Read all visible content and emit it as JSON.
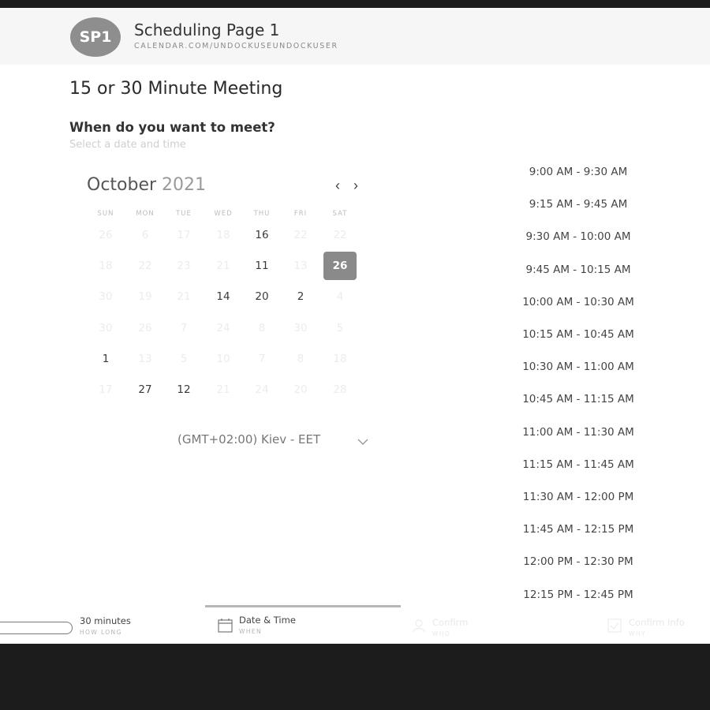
{
  "header": {
    "avatar_initials": "SP1",
    "page_name": "Scheduling Page 1",
    "page_url": "CALENDAR.COM/UNDOCKUSEUNDOCKUSER"
  },
  "event": {
    "title": "15 or 30 Minute Meeting",
    "question": "When do you want to meet?",
    "subtitle": "Select a date and time"
  },
  "calendar": {
    "month": "October",
    "year": "2021",
    "prev_icon": "‹",
    "next_icon": "›",
    "weekdays": [
      "SUN",
      "MON",
      "TUE",
      "WED",
      "THU",
      "FRI",
      "SAT"
    ],
    "weeks": [
      [
        {
          "t": "26",
          "s": "muted"
        },
        {
          "t": "6",
          "s": "muted"
        },
        {
          "t": "17",
          "s": "muted"
        },
        {
          "t": "18",
          "s": "muted"
        },
        {
          "t": "16",
          "s": "avail"
        },
        {
          "t": "22",
          "s": "muted"
        },
        {
          "t": "22",
          "s": "muted"
        }
      ],
      [
        {
          "t": "18",
          "s": "muted"
        },
        {
          "t": "22",
          "s": "muted"
        },
        {
          "t": "23",
          "s": "muted"
        },
        {
          "t": "21",
          "s": "muted"
        },
        {
          "t": "11",
          "s": "avail"
        },
        {
          "t": "13",
          "s": "muted"
        },
        {
          "t": "26",
          "s": "selected"
        }
      ],
      [
        {
          "t": "30",
          "s": "muted"
        },
        {
          "t": "19",
          "s": "muted"
        },
        {
          "t": "21",
          "s": "muted"
        },
        {
          "t": "14",
          "s": "avail"
        },
        {
          "t": "20",
          "s": "avail"
        },
        {
          "t": "2",
          "s": "avail"
        },
        {
          "t": "4",
          "s": "muted"
        }
      ],
      [
        {
          "t": "30",
          "s": "muted"
        },
        {
          "t": "26",
          "s": "muted"
        },
        {
          "t": "7",
          "s": "muted"
        },
        {
          "t": "24",
          "s": "muted"
        },
        {
          "t": "8",
          "s": "muted"
        },
        {
          "t": "30",
          "s": "muted"
        },
        {
          "t": "5",
          "s": "muted"
        }
      ],
      [
        {
          "t": "1",
          "s": "avail"
        },
        {
          "t": "13",
          "s": "muted"
        },
        {
          "t": "5",
          "s": "muted"
        },
        {
          "t": "10",
          "s": "muted"
        },
        {
          "t": "7",
          "s": "muted"
        },
        {
          "t": "8",
          "s": "muted"
        },
        {
          "t": "18",
          "s": "muted"
        }
      ],
      [
        {
          "t": "17",
          "s": "muted"
        },
        {
          "t": "27",
          "s": "avail"
        },
        {
          "t": "12",
          "s": "avail"
        },
        {
          "t": "21",
          "s": "muted"
        },
        {
          "t": "24",
          "s": "muted"
        },
        {
          "t": "20",
          "s": "muted"
        },
        {
          "t": "28",
          "s": "muted"
        }
      ]
    ],
    "timezone": "(GMT+02:00) Kiev - EET"
  },
  "slots": [
    "9:00 AM - 9:30 AM",
    "9:15 AM - 9:45 AM",
    "9:30 AM - 10:00 AM",
    "9:45 AM - 10:15 AM",
    "10:00 AM - 10:30 AM",
    "10:15 AM - 10:45 AM",
    "10:30 AM - 11:00 AM",
    "10:45 AM - 11:15 AM",
    "11:00 AM - 11:30 AM",
    "11:15 AM - 11:45 AM",
    "11:30 AM - 12:00 PM",
    "11:45 AM - 12:15 PM",
    "12:00 PM - 12:30 PM",
    "12:15 PM - 12:45 PM"
  ],
  "footer": {
    "steps": [
      {
        "label": "30 minutes",
        "sub": "HOW LONG",
        "icon": "progress-icon"
      },
      {
        "label": "Date & Time",
        "sub": "WHEN",
        "icon": "calendar-icon"
      },
      {
        "label": "Confirm",
        "sub": "WHO",
        "icon": "user-icon"
      },
      {
        "label": "Confirm Info",
        "sub": "WHY",
        "icon": "check-icon"
      }
    ]
  }
}
